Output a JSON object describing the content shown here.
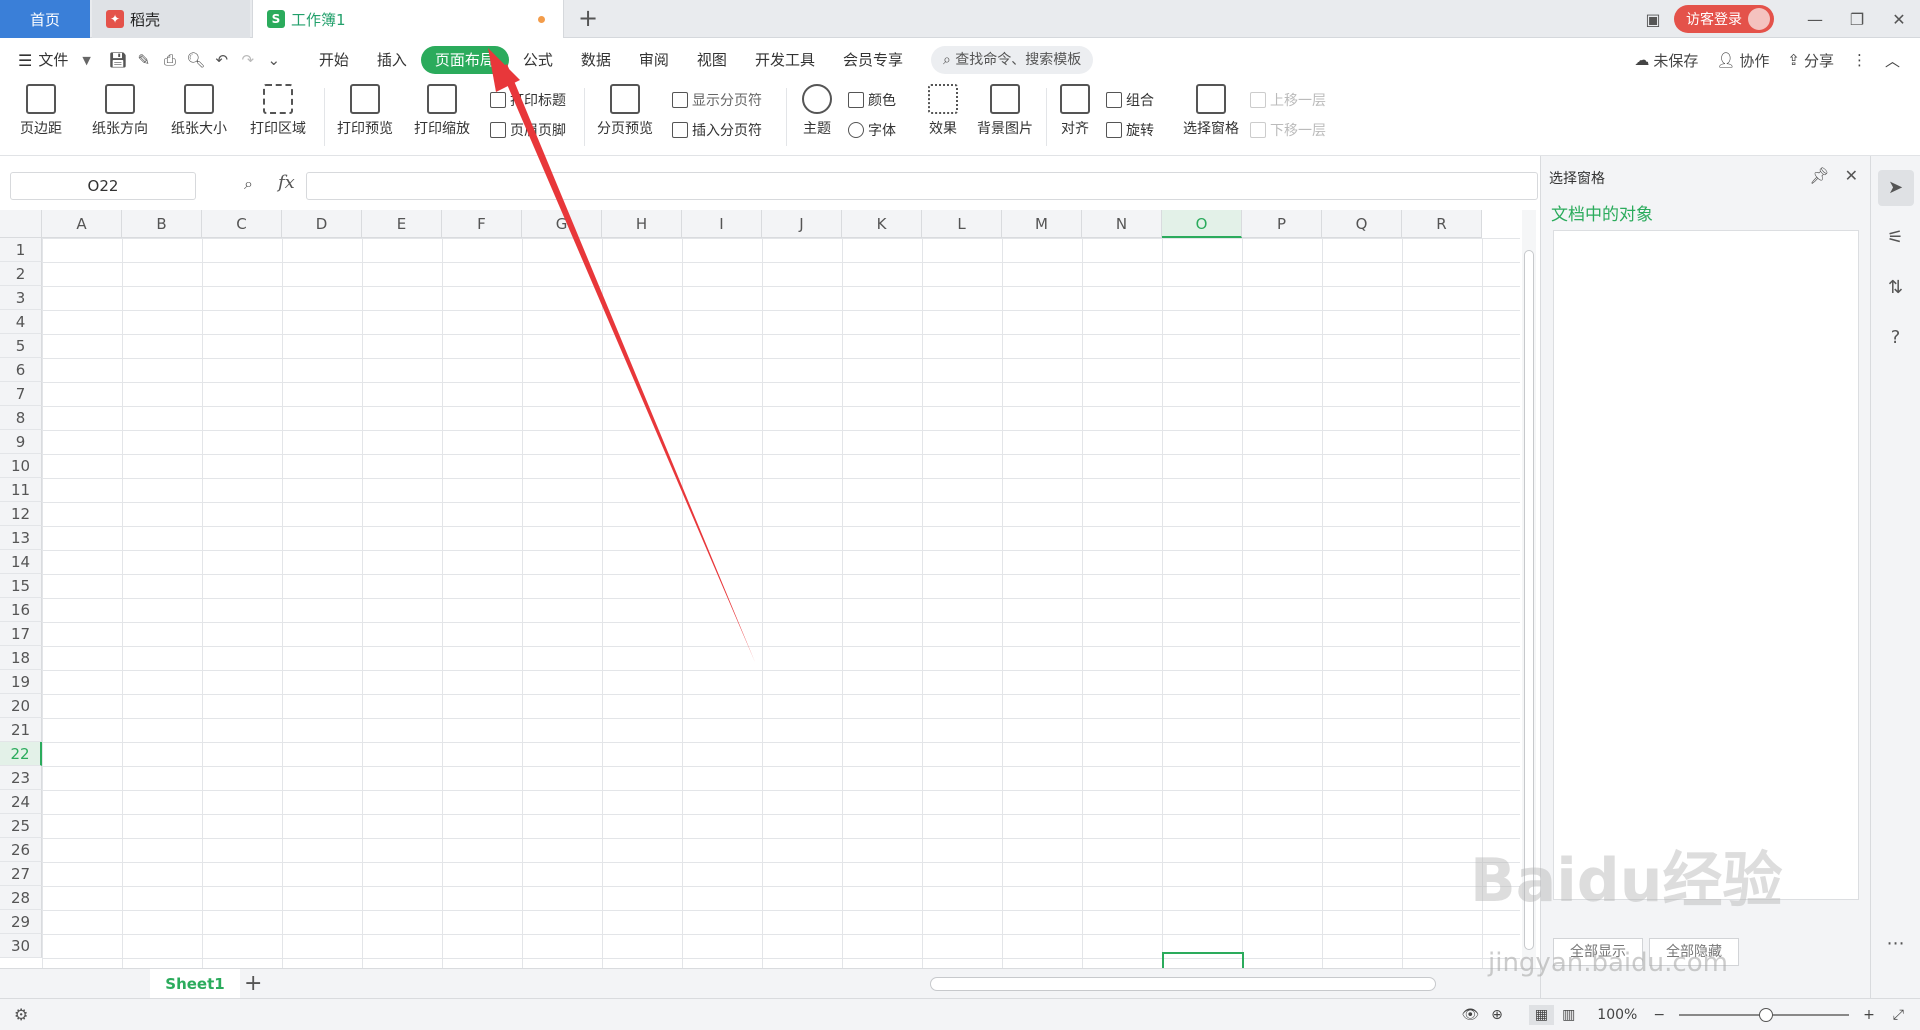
{
  "tabs": [
    {
      "label": "首页"
    },
    {
      "label": "稻壳"
    },
    {
      "label": "工作簿1"
    }
  ],
  "window": {
    "login_label": "访客登录"
  },
  "menu": {
    "file": "文件",
    "items": [
      "开始",
      "插入",
      "页面布局",
      "公式",
      "数据",
      "审阅",
      "视图",
      "开发工具",
      "会员专享"
    ],
    "active_index": 2,
    "search_placeholder": "查找命令、搜索模板",
    "unsaved": "未保存",
    "collab": "协作",
    "share": "分享"
  },
  "ribbon": {
    "margins": "页边距",
    "orientation": "纸张方向",
    "size": "纸张大小",
    "print_area": "打印区域",
    "print_preview": "打印预览",
    "print_scale": "打印缩放",
    "print_titles": "打印标题",
    "header_footer": "页眉页脚",
    "page_break_preview": "分页预览",
    "show_page_breaks": "显示分页符",
    "insert_page_break": "插入分页符",
    "theme": "主题",
    "colors": "颜色",
    "fonts": "字体",
    "effects": "效果",
    "background": "背景图片",
    "align": "对齐",
    "group": "组合",
    "rotate": "旋转",
    "selection_pane": "选择窗格",
    "bring_forward": "上移一层",
    "send_backward": "下移一层"
  },
  "formula_bar": {
    "name_box": "O22",
    "fx": "fx",
    "value": ""
  },
  "grid": {
    "columns": [
      "A",
      "B",
      "C",
      "D",
      "E",
      "F",
      "G",
      "H",
      "I",
      "J",
      "K",
      "L",
      "M",
      "N",
      "O",
      "P",
      "Q",
      "R"
    ],
    "rows": [
      "1",
      "2",
      "3",
      "4",
      "5",
      "6",
      "7",
      "8",
      "9",
      "10",
      "11",
      "12",
      "13",
      "14",
      "15",
      "16",
      "17",
      "18",
      "19",
      "20",
      "21",
      "22",
      "23",
      "24",
      "25",
      "26",
      "27",
      "28",
      "29",
      "30"
    ],
    "selected_column": "O",
    "selected_row": "22"
  },
  "sheets": {
    "active": "Sheet1"
  },
  "status": {
    "zoom": "100%"
  },
  "pane": {
    "title": "选择窗格",
    "subtitle": "文档中的对象",
    "show_all": "全部显示",
    "hide_all": "全部隐藏"
  },
  "watermark": {
    "text": "Baidu经验",
    "url": "jingyan.baidu.com"
  },
  "colors": {
    "accent": "#2bab5c",
    "tab_home": "#3a7fd8",
    "login": "#e4524a",
    "arrow": "#e8373a"
  }
}
